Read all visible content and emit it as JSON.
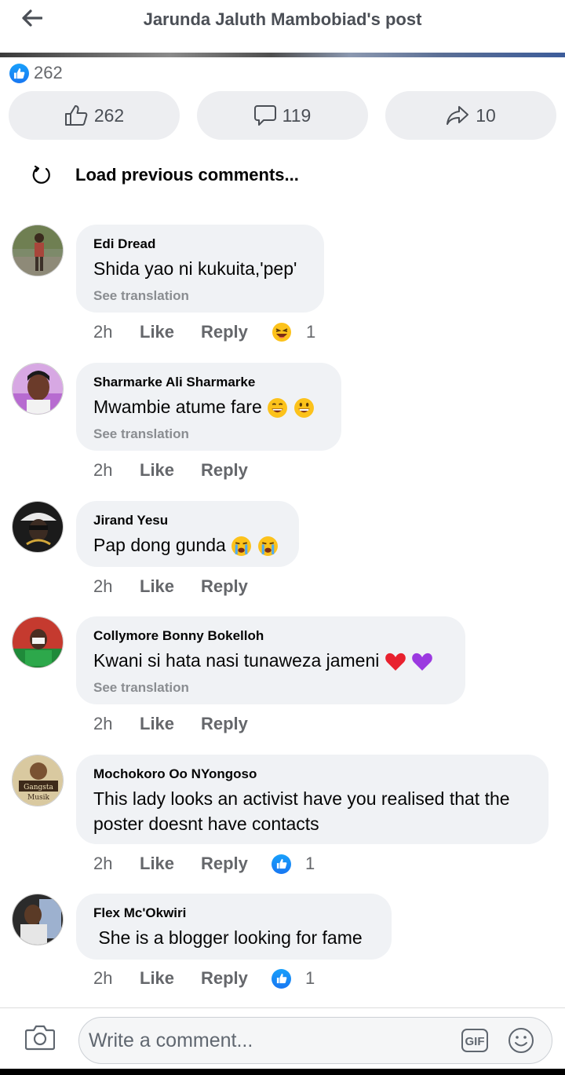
{
  "header": {
    "title": "Jarunda Jaluth Mambobiad's post"
  },
  "reactions": {
    "count": "262"
  },
  "actions": {
    "like_count": "262",
    "comment_count": "119",
    "share_count": "10"
  },
  "load_previous": "Load previous comments...",
  "comments": [
    {
      "author": "Edi Dread",
      "text": "Shida yao ni kukuita,'pep'",
      "see_translation": "See translation",
      "time": "2h",
      "like": "Like",
      "reply": "Reply",
      "reaction_icon": "laughing-emoji-icon",
      "reaction_count": "1"
    },
    {
      "author": "Sharmarke Ali Sharmarke",
      "text": "Mwambie atume fare",
      "see_translation": "See translation",
      "time": "2h",
      "like": "Like",
      "reply": "Reply"
    },
    {
      "author": "Jirand Yesu",
      "text": "Pap dong gunda",
      "time": "2h",
      "like": "Like",
      "reply": "Reply"
    },
    {
      "author": "Collymore Bonny Bokelloh",
      "text": "Kwani si hata nasi tunaweza jameni",
      "see_translation": "See translation",
      "time": "2h",
      "like": "Like",
      "reply": "Reply"
    },
    {
      "author": "Mochokoro Oo NYongoso",
      "text_line1": "This lady looks an activist have you realised that the",
      "text_line2": "poster doesnt have contacts",
      "time": "2h",
      "like": "Like",
      "reply": "Reply",
      "reaction_icon": "like-reaction-icon",
      "reaction_count": "1"
    },
    {
      "author": "Flex Mc'Okwiri",
      "text": " She is a blogger looking for fame",
      "time": "2h",
      "like": "Like",
      "reply": "Reply",
      "reaction_icon": "like-reaction-icon",
      "reaction_count": "1"
    }
  ],
  "composer": {
    "placeholder": "Write a comment...",
    "gif_label": "GIF"
  },
  "colors": {
    "brand": "#1877f2",
    "bubble": "#f0f2f5",
    "meta": "#65676b"
  }
}
